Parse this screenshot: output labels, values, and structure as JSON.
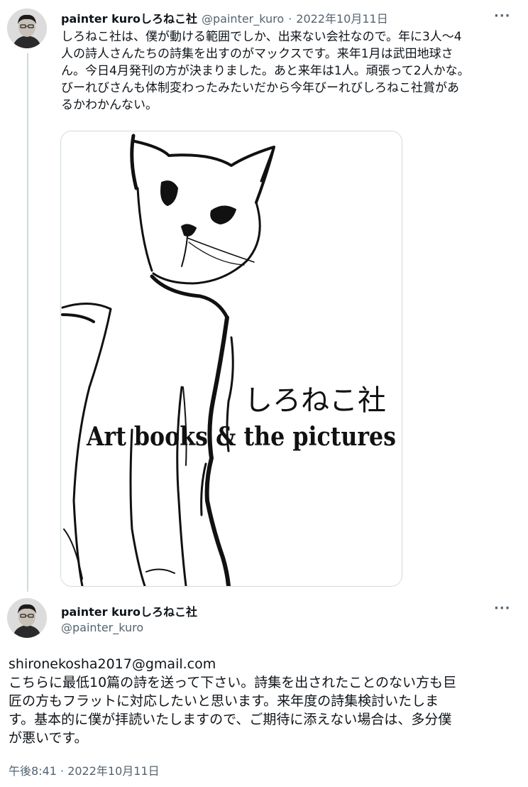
{
  "tweet1": {
    "author_name": "painter kuroしろねこ社",
    "handle": "@painter_kuro",
    "separator": "·",
    "date": "2022年10月11日",
    "more": "···",
    "text": "しろねこ社は、僕が動ける範囲でしか、出来ない会社なので。年に3人〜4\n人の詩人さんたちの詩集を出すのがマックスです。来年1月は武田地球さ\nん。今日4月発刊の方が決まりました。あと来年は1人。頑張って2人かな。\nびーれびさんも体制変わったみたいだから今年びーれびしろねこ社賞があ\nるかわかんない。",
    "image": {
      "title_jp": "しろねこ社",
      "title_en": "Art books & the pictures"
    }
  },
  "tweet2": {
    "author_name": "painter kuroしろねこ社",
    "handle": "@painter_kuro",
    "more": "···",
    "text": "shironekosha2017@gmail.com\nこちらに最低10篇の詩を送って下さい。詩集を出されたことのない方も巨\n匠の方もフラットに対応したいと思います。来年度の詩集検討いたしま\nす。基本的に僕が拝読いたしますので、ご期待に添えない場合は、多分僕\nが悪いです。",
    "timestamp": "午後8:41 · 2022年10月11日"
  }
}
